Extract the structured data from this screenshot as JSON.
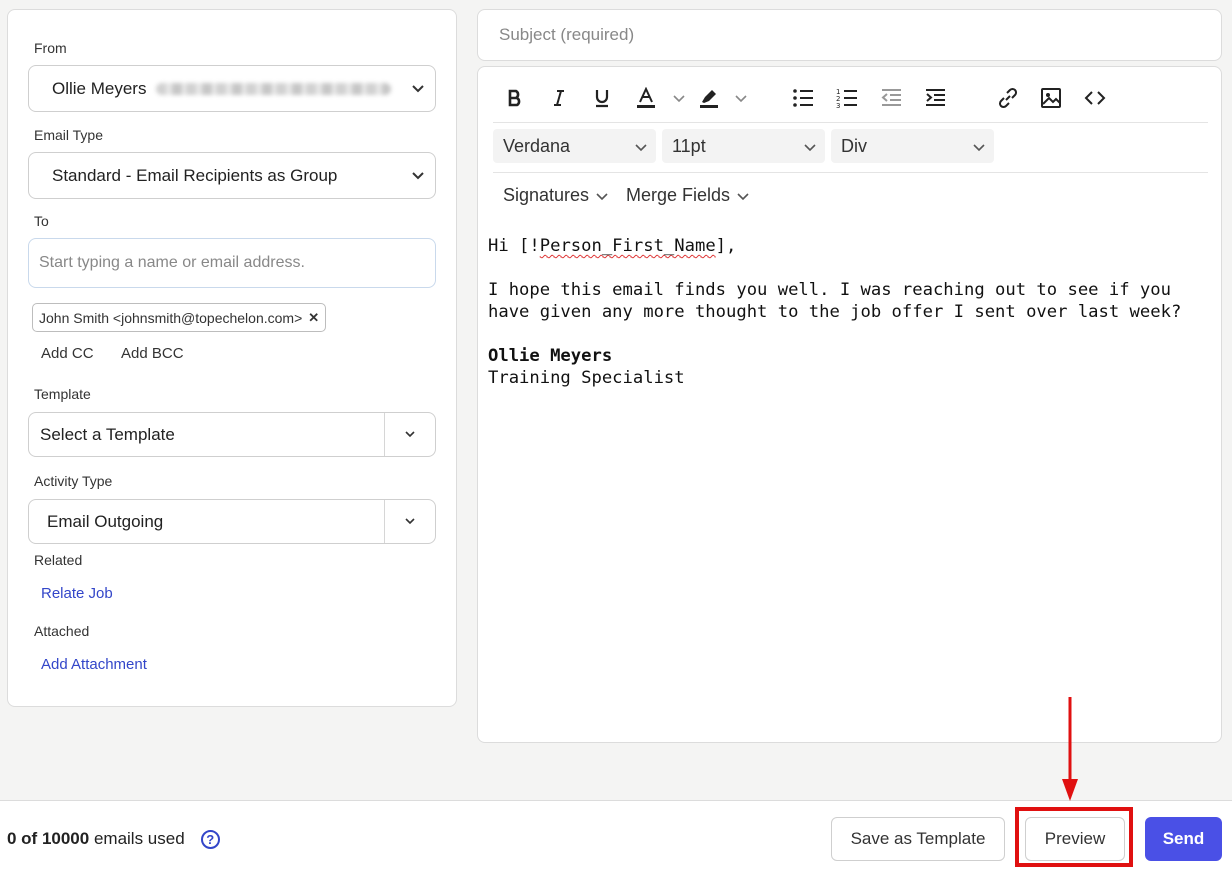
{
  "form": {
    "from_label": "From",
    "from_value": "Ollie Meyers",
    "email_type_label": "Email Type",
    "email_type_value": "Standard - Email Recipients as Group",
    "to_label": "To",
    "to_placeholder": "Start typing a name or email address.",
    "recipient_chip": "John Smith <johnsmith@topechelon.com>",
    "add_cc": "Add CC",
    "add_bcc": "Add BCC",
    "template_label": "Template",
    "template_value": "Select a Template",
    "activity_type_label": "Activity Type",
    "activity_type_value": "Email Outgoing",
    "related_label": "Related",
    "relate_job": "Relate Job",
    "attached_label": "Attached",
    "add_attachment": "Add Attachment"
  },
  "editor": {
    "subject_placeholder": "Subject (required)",
    "toolbar_icons": [
      "bold-icon",
      "italic-icon",
      "underline-icon",
      "text-color-icon",
      "highlight-icon",
      "bullet-list-icon",
      "numbered-list-icon",
      "outdent-icon",
      "indent-icon",
      "link-icon",
      "image-icon",
      "code-icon"
    ],
    "font_family": "Verdana",
    "font_size": "11pt",
    "block_format": "Div",
    "signatures": "Signatures",
    "merge_fields": "Merge Fields",
    "body": {
      "greeting_prefix": "Hi [!",
      "merge_field": "Person_First_Name",
      "greeting_suffix": "],",
      "paragraph": "I hope this email finds you well. I was reaching out to see if you have given any more thought to the job offer I sent over last week?",
      "signature_name": "Ollie Meyers",
      "signature_title": "Training Specialist"
    }
  },
  "footer": {
    "usage_count": "0 of 10000",
    "usage_suffix": " emails used",
    "help": "?",
    "save_as_template": "Save as Template",
    "preview": "Preview",
    "send": "Send"
  },
  "colors": {
    "accent": "#4a50e6",
    "link": "#3346c9",
    "annotation": "#e01010"
  }
}
